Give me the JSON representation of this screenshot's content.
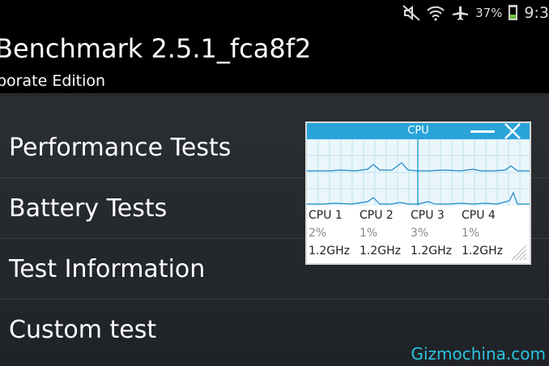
{
  "status_bar": {
    "battery_percent": "37%",
    "battery_level": 0.37,
    "clock": "9:3",
    "icons": [
      "mute-icon",
      "wifi-icon",
      "airplane-icon",
      "battery-icon"
    ]
  },
  "header": {
    "title": "Benchmark 2.5.1_fca8f2",
    "subtitle": "porate Edition"
  },
  "menu": {
    "items": [
      {
        "label": "Performance Tests"
      },
      {
        "label": "Battery Tests"
      },
      {
        "label": "Test Information"
      },
      {
        "label": "Custom test"
      }
    ]
  },
  "cpu_widget": {
    "title": "CPU",
    "accent": "#2aa3d8",
    "cpus": [
      {
        "name": "CPU 1",
        "load": "2%",
        "freq": "1.2GHz"
      },
      {
        "name": "CPU 2",
        "load": "1%",
        "freq": "1.2GHz"
      },
      {
        "name": "CPU 3",
        "load": "3%",
        "freq": "1.2GHz"
      },
      {
        "name": "CPU 4",
        "load": "1%",
        "freq": "1.2GHz"
      }
    ]
  },
  "watermark": "Gizmochina.com"
}
